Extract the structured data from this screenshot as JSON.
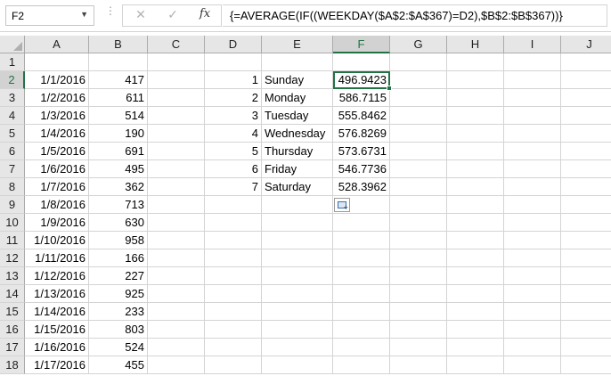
{
  "formula_bar": {
    "name_box": "F2",
    "formula": "{=AVERAGE(IF((WEEKDAY($A$2:$A$367)=D2),$B$2:$B$367))}",
    "insert_function_label": "fx"
  },
  "columns": [
    "A",
    "B",
    "C",
    "D",
    "E",
    "F",
    "G",
    "H",
    "I",
    "J"
  ],
  "selected_column": "F",
  "rows": [
    {
      "num": "1",
      "A": "",
      "B": "",
      "D": "",
      "E": "",
      "F": ""
    },
    {
      "num": "2",
      "A": "1/1/2016",
      "B": "417",
      "D": "1",
      "E": "Sunday",
      "F": "496.9423"
    },
    {
      "num": "3",
      "A": "1/2/2016",
      "B": "611",
      "D": "2",
      "E": "Monday",
      "F": "586.7115"
    },
    {
      "num": "4",
      "A": "1/3/2016",
      "B": "514",
      "D": "3",
      "E": "Tuesday",
      "F": "555.8462"
    },
    {
      "num": "5",
      "A": "1/4/2016",
      "B": "190",
      "D": "4",
      "E": "Wednesday",
      "F": "576.8269"
    },
    {
      "num": "6",
      "A": "1/5/2016",
      "B": "691",
      "D": "5",
      "E": "Thursday",
      "F": "573.6731"
    },
    {
      "num": "7",
      "A": "1/6/2016",
      "B": "495",
      "D": "6",
      "E": "Friday",
      "F": "546.7736"
    },
    {
      "num": "8",
      "A": "1/7/2016",
      "B": "362",
      "D": "7",
      "E": "Saturday",
      "F": "528.3962"
    },
    {
      "num": "9",
      "A": "1/8/2016",
      "B": "713",
      "D": "",
      "E": "",
      "F": ""
    },
    {
      "num": "10",
      "A": "1/9/2016",
      "B": "630",
      "D": "",
      "E": "",
      "F": ""
    },
    {
      "num": "11",
      "A": "1/10/2016",
      "B": "958",
      "D": "",
      "E": "",
      "F": ""
    },
    {
      "num": "12",
      "A": "1/11/2016",
      "B": "166",
      "D": "",
      "E": "",
      "F": ""
    },
    {
      "num": "13",
      "A": "1/12/2016",
      "B": "227",
      "D": "",
      "E": "",
      "F": ""
    },
    {
      "num": "14",
      "A": "1/13/2016",
      "B": "925",
      "D": "",
      "E": "",
      "F": ""
    },
    {
      "num": "15",
      "A": "1/14/2016",
      "B": "233",
      "D": "",
      "E": "",
      "F": ""
    },
    {
      "num": "16",
      "A": "1/15/2016",
      "B": "803",
      "D": "",
      "E": "",
      "F": ""
    },
    {
      "num": "17",
      "A": "1/16/2016",
      "B": "524",
      "D": "",
      "E": "",
      "F": ""
    },
    {
      "num": "18",
      "A": "1/17/2016",
      "B": "455",
      "D": "",
      "E": "",
      "F": ""
    }
  ],
  "active_cell": "F2",
  "colors": {
    "accent": "#217346",
    "header_bg": "#e6e6e6",
    "gridline": "#d4d4d4"
  }
}
